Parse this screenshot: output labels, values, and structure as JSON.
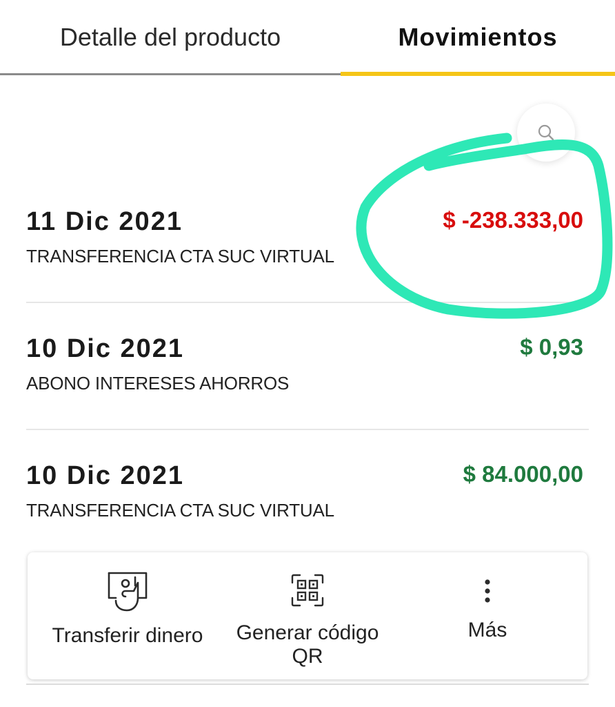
{
  "tabs": {
    "detail_label": "Detalle del producto",
    "movements_label": "Movimientos"
  },
  "transactions": [
    {
      "date": "11 Dic 2021",
      "description": "TRANSFERENCIA CTA SUC VIRTUAL",
      "amount": "$ -238.333,00",
      "sign": "negative"
    },
    {
      "date": "10 Dic 2021",
      "description": "ABONO INTERESES AHORROS",
      "amount": "$ 0,93",
      "sign": "positive"
    },
    {
      "date": "10 Dic 2021",
      "description": "TRANSFERENCIA CTA SUC VIRTUAL",
      "amount": "$ 84.000,00",
      "sign": "positive"
    }
  ],
  "actions": {
    "transfer_label": "Transferir dinero",
    "qr_label_line1": "Generar código",
    "qr_label_line2": "QR",
    "more_label": "Más"
  },
  "colors": {
    "active_tab": "#f5c518",
    "negative_amount": "#d80d0d",
    "positive_amount": "#1f7a3e",
    "annotation": "#2ee8b6"
  },
  "icons": {
    "search": "search-icon",
    "transfer": "transfer-money-icon",
    "qr": "qr-code-icon",
    "more": "more-vertical-icon"
  }
}
